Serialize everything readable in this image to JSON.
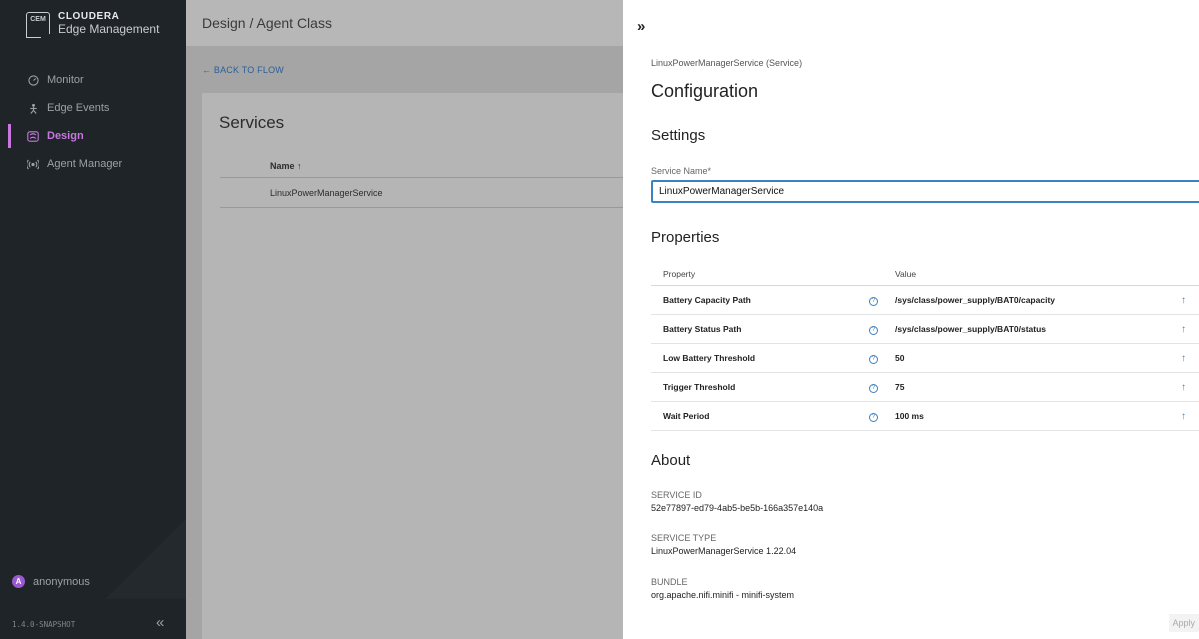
{
  "sidebar": {
    "brand_name": "CLOUDERA",
    "brand_sub": "Edge Management",
    "logo_text": "CEM",
    "items": [
      {
        "label": "Monitor",
        "icon": "gauge-icon"
      },
      {
        "label": "Edge Events",
        "icon": "person-icon"
      },
      {
        "label": "Design",
        "icon": "flow-icon",
        "active": true
      },
      {
        "label": "Agent Manager",
        "icon": "broadcast-icon"
      }
    ],
    "user": {
      "name": "anonymous",
      "initial": "A"
    },
    "version": "1.4.0-SNAPSHOT",
    "collapse_icon": "double-chevron-left-icon"
  },
  "main": {
    "breadcrumb": "Design / Agent Class",
    "back_link": "← BACK TO FLOW",
    "card_title": "Services",
    "column_name": "Name ↑",
    "rows": [
      "LinuxPowerManagerService"
    ]
  },
  "panel": {
    "expand_icon": "»",
    "subtitle": "LinuxPowerManagerService (Service)",
    "title": "Configuration",
    "settings_heading": "Settings",
    "service_name_label": "Service Name*",
    "service_name_value": "LinuxPowerManagerService",
    "properties_heading": "Properties",
    "properties_columns": {
      "property": "Property",
      "value": "Value"
    },
    "properties": [
      {
        "name": "Battery Capacity Path",
        "value": "/sys/class/power_supply/BAT0/capacity"
      },
      {
        "name": "Battery Status Path",
        "value": "/sys/class/power_supply/BAT0/status"
      },
      {
        "name": "Low Battery Threshold",
        "value": "50"
      },
      {
        "name": "Trigger Threshold",
        "value": "75"
      },
      {
        "name": "Wait Period",
        "value": "100 ms"
      }
    ],
    "about_heading": "About",
    "service_id_label": "SERVICE ID",
    "service_id": "52e77897-ed79-4ab5-be5b-166a357e140a",
    "service_type_label": "SERVICE TYPE",
    "service_type": "LinuxPowerManagerService 1.22.04",
    "bundle_label": "BUNDLE",
    "bundle": "org.apache.nifi.minifi - minifi-system",
    "apply_label": "Apply"
  },
  "colors": {
    "accent": "#c678dd",
    "link": "#3b7fc4",
    "sidebar_bg": "#1f2428"
  }
}
